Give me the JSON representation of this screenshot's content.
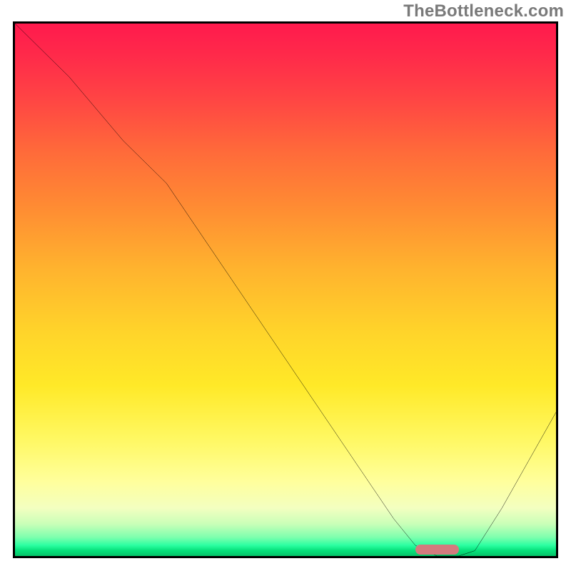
{
  "watermark": "TheBottleneck.com",
  "colors": {
    "border": "#000000",
    "curve": "#000000",
    "marker": "#d47a7e",
    "gradient_top": "#ff1a4d",
    "gradient_bottom": "#06c469"
  },
  "chart_data": {
    "type": "line",
    "title": "",
    "xlabel": "",
    "ylabel": "",
    "xlim": [
      0,
      100
    ],
    "ylim": [
      0,
      100
    ],
    "grid": false,
    "legend": false,
    "axis_ticks": false,
    "series": [
      {
        "name": "bottleneck-curve",
        "x": [
          0,
          10,
          20,
          28,
          40,
          50,
          60,
          70,
          74,
          78,
          82,
          85,
          90,
          95,
          100
        ],
        "values": [
          100,
          90,
          78,
          70,
          52,
          37,
          22,
          7,
          2,
          0,
          0,
          1,
          9,
          18,
          27
        ]
      }
    ],
    "optimal_marker": {
      "x_start": 74,
      "x_end": 82,
      "y": 0.5
    },
    "background_scale": {
      "type": "vertical-gradient",
      "top_meaning": "high-bottleneck",
      "bottom_meaning": "no-bottleneck"
    }
  }
}
